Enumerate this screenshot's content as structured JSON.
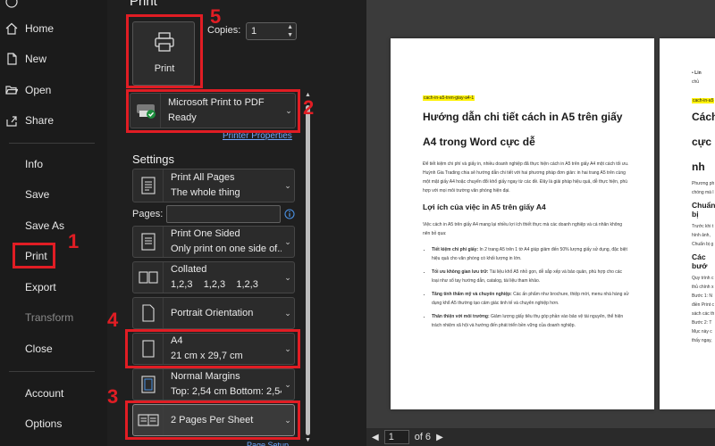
{
  "nav": {
    "items": [
      {
        "label": "Home",
        "icon": "home-icon"
      },
      {
        "label": "New",
        "icon": "new-document-icon"
      },
      {
        "label": "Open",
        "icon": "folder-open-icon"
      },
      {
        "label": "Share",
        "icon": "share-icon"
      },
      {
        "label": "Info"
      },
      {
        "label": "Save"
      },
      {
        "label": "Save As"
      },
      {
        "label": "Print",
        "selected": true
      },
      {
        "label": "Export"
      },
      {
        "label": "Transform",
        "disabled": true
      },
      {
        "label": "Close"
      },
      {
        "label": "Account"
      },
      {
        "label": "Options"
      }
    ]
  },
  "print": {
    "title": "Print",
    "button_label": "Print",
    "copies_label": "Copies:",
    "copies_value": "1"
  },
  "printer": {
    "name": "Microsoft Print to PDF",
    "status": "Ready",
    "properties_link": "Printer Properties"
  },
  "settings": {
    "title": "Settings",
    "pages_label": "Pages:",
    "pages_value": "",
    "print_range": {
      "line1": "Print All Pages",
      "line2": "The whole thing"
    },
    "sides": {
      "line1": "Print One Sided",
      "line2": "Only print on one side of..."
    },
    "collation": {
      "line1": "Collated",
      "line2": "1,2,3    1,2,3    1,2,3"
    },
    "orientation": {
      "line1": "Portrait Orientation"
    },
    "paper": {
      "line1": "A4",
      "line2": "21 cm x 29,7 cm"
    },
    "margins": {
      "line1": "Normal Margins",
      "line2": "Top: 2,54 cm Bottom: 2,54..."
    },
    "per_sheet": {
      "line1": "2 Pages Per Sheet"
    },
    "page_setup": "Page Setup"
  },
  "annotations": {
    "n1": "1",
    "n2": "2",
    "n3": "3",
    "n4": "4",
    "n5": "5",
    "color": "#e11d24"
  },
  "preview": {
    "page1": {
      "tag": "cach-in-a5-tren-giay-a4-1",
      "title_line1": "Hướng dẫn chi tiết cách in A5 trên giấy",
      "title_line2": "A4 trong Word cực dễ",
      "intro": "Để tiết kiệm chi phí và giấy in, nhiều doanh nghiệp đã thực hiện cách in A5 trên giấy A4 một cách tối ưu. Huỳnh Gia Trading chia sẻ hướng dẫn chi tiết với hai phương pháp đơn giản: in hai trang A5 trên cùng một mặt giấy A4 hoặc chuyển đổi khổ giấy ngay từ các đề. Đây là giải pháp hiệu quả, dễ thực hiện, phù hợp với mọi môi trường văn phòng hiện đại.",
      "heading": "Lợi ích của việc in A5 trên giấy A4",
      "para": "Việc cách in A5 trên giấy A4 mang lại nhiều lợi ích thiết thực mà các doanh nghiệp và cá nhân không nên bỏ qua:",
      "bullets": [
        {
          "bold": "Tiết kiệm chi phí giấy:",
          "text": " In 2 trang A5 trên 1 tờ A4 giúp giảm đến 50% lượng giấy sử dụng, đặc biệt hiệu quả cho văn phòng có khối lượng in lớn."
        },
        {
          "bold": "Tối ưu không gian lưu trữ:",
          "text": " Tài liệu khổ A5 nhỏ gọn, dễ sắp xếp và bảo quản, phù hợp cho các loại như sổ tay hướng dẫn, catalog, tài liệu tham khảo."
        },
        {
          "bold": "Tăng tính thẩm mỹ và chuyên nghiệp:",
          "text": " Các ấn phẩm như brochure, thiệp mời, menu nhà hàng sử dụng khổ A5 thường tạo cảm giác tinh tế và chuyên nghiệp hơn."
        },
        {
          "bold": "Thân thiện với môi trường:",
          "text": " Giảm lượng giấy tiêu thụ góp phần vào bảo vệ tài nguyên, thể hiện trách nhiệm xã hội và hướng đến phát triển bền vững của doanh nghiệp."
        }
      ]
    },
    "page2": {
      "bullet_a": "Lin",
      "bullet_b": "chủ",
      "tag": "cach-in-a5",
      "title_line1": "Cách",
      "title_line2": "cực nh",
      "lines": [
        "Phương ph",
        "chóng mà l"
      ],
      "heading": "Chuẩn bị",
      "lines2": [
        "Trước khi t",
        "hình ảnh,",
        "Chuẩn bị g"
      ],
      "heading2": "Các bướ",
      "lines3": [
        "Quy trình c",
        "thủ chính x",
        "Bước 1: N",
        "điền Print c",
        "sách các th",
        "Bước 2: T",
        "Mục này c",
        "thấy ngay,"
      ]
    },
    "current_page": "1",
    "total_pages": "of 6"
  }
}
